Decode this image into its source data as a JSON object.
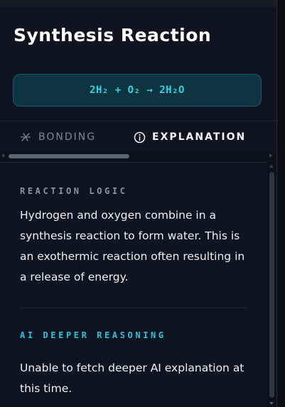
{
  "header": {
    "title": "Synthesis Reaction",
    "equation": "2H₂ + O₂ → 2H₂O"
  },
  "tabs": [
    {
      "label": "BONDING",
      "icon": "atom-icon",
      "active": false
    },
    {
      "label": "EXPLANATION",
      "icon": "info-icon",
      "active": true
    }
  ],
  "sections": {
    "logic": {
      "heading": "REACTION LOGIC",
      "text": "Hydrogen and oxygen combine in a synthesis reaction to form water. This is an exothermic reaction often resulting in a release of energy."
    },
    "ai": {
      "heading": "AI DEEPER REASONING",
      "text": "Unable to fetch deeper AI explanation at this time."
    }
  },
  "colors": {
    "background": "#0e1520",
    "accent": "#27c3dd",
    "equation_bg": "#0e3440",
    "muted": "#7d8896"
  }
}
